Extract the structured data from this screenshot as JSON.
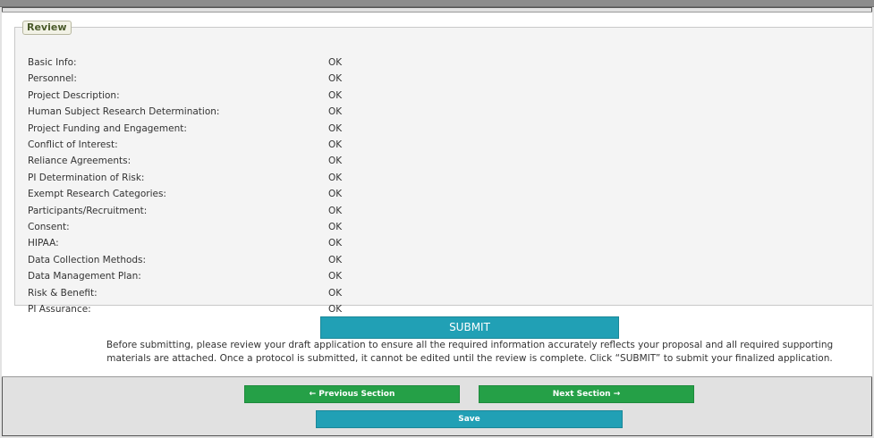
{
  "review": {
    "legend": "Review",
    "items": [
      {
        "label": "Basic Info:",
        "status": "OK"
      },
      {
        "label": "Personnel:",
        "status": "OK"
      },
      {
        "label": "Project Description:",
        "status": "OK"
      },
      {
        "label": "Human Subject Research Determination:",
        "status": "OK"
      },
      {
        "label": "Project Funding and Engagement:",
        "status": "OK"
      },
      {
        "label": "Conflict of Interest:",
        "status": "OK"
      },
      {
        "label": "Reliance Agreements:",
        "status": "OK"
      },
      {
        "label": "PI Determination of Risk:",
        "status": "OK"
      },
      {
        "label": "Exempt Research Categories:",
        "status": "OK"
      },
      {
        "label": "Participants/Recruitment:",
        "status": "OK"
      },
      {
        "label": "Consent:",
        "status": "OK"
      },
      {
        "label": "HIPAA:",
        "status": "OK"
      },
      {
        "label": "Data Collection Methods:",
        "status": "OK"
      },
      {
        "label": "Data Management Plan:",
        "status": "OK"
      },
      {
        "label": "Risk & Benefit:",
        "status": "OK"
      },
      {
        "label": "PI Assurance:",
        "status": "OK"
      }
    ]
  },
  "submit": {
    "label": "SUBMIT",
    "note": "Before submitting, please review your draft application to ensure all the required information accurately reflects your proposal and all required supporting materials are attached. Once a protocol is submitted, it cannot be edited until the review is complete. Click “SUBMIT” to submit your finalized application."
  },
  "navigation": {
    "prev_label": "Previous Section",
    "prev_icon": "arrow-left-icon",
    "next_label": "Next Section",
    "next_icon": "arrow-right-icon",
    "save_label": "Save"
  },
  "colors": {
    "submit_button": "#21a0b5",
    "nav_button": "#25a047",
    "save_button": "#21a0b5",
    "legend_text": "#4a5a2a"
  }
}
